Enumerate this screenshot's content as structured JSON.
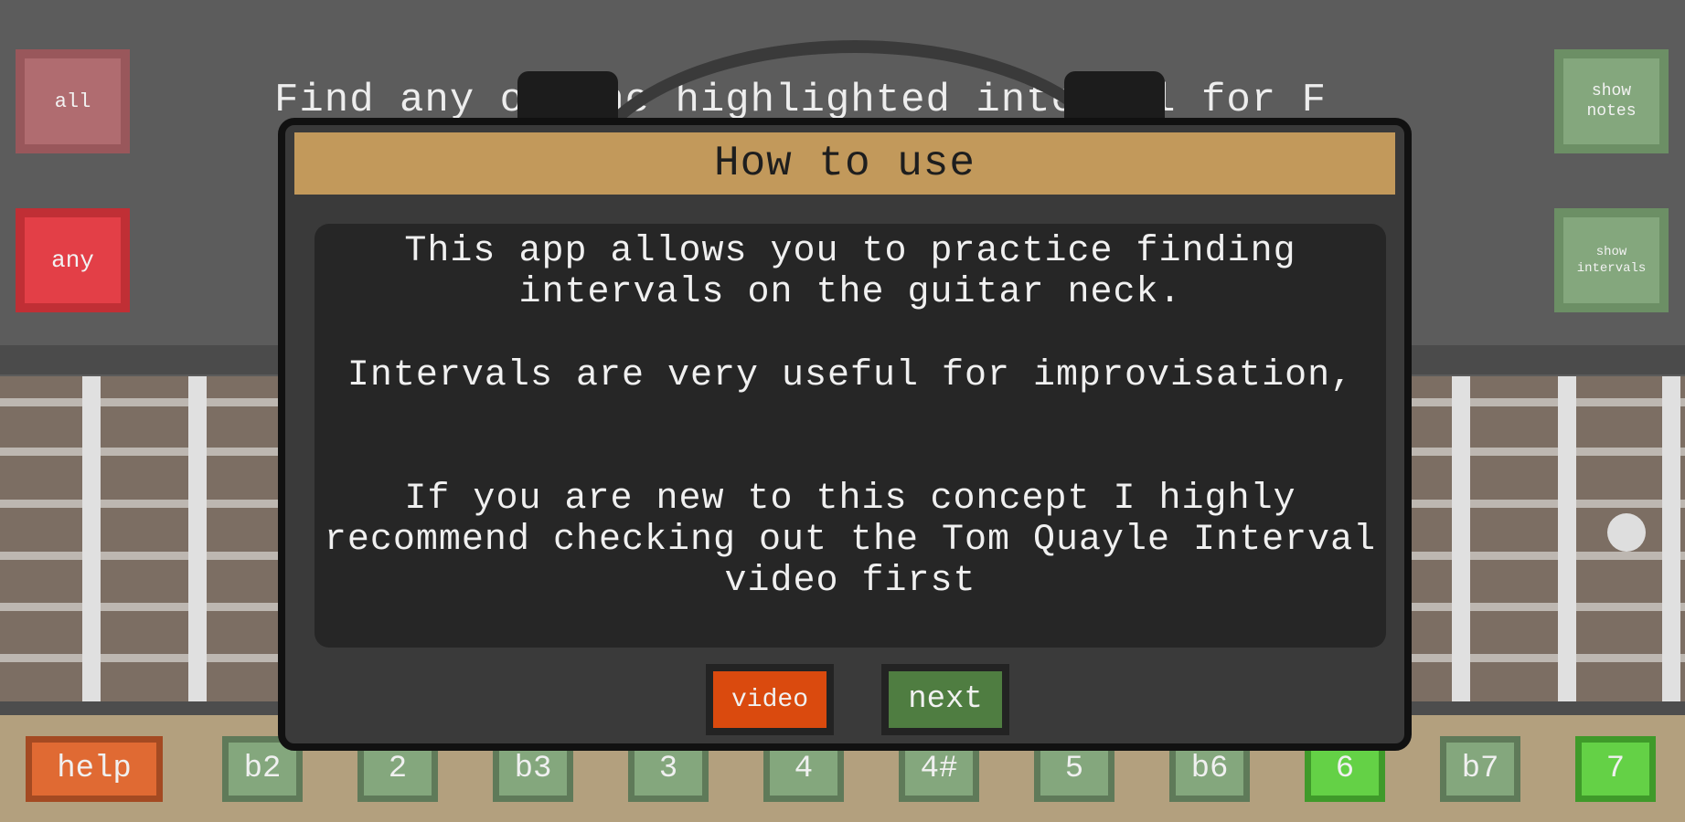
{
  "prompt": "Find any of the highlighted interval for F",
  "left_controls": {
    "all_label": "all",
    "any_label": "any"
  },
  "right_controls": {
    "show_notes_label": "show notes",
    "show_intervals_label": "show intervals"
  },
  "modal": {
    "title": "How to use",
    "paragraphs": [
      "This app allows you to practice finding intervals on the guitar neck.",
      "Intervals are very useful for improvisation,",
      "If you are new to this concept I highly recommend checking out the Tom Quayle Interval video first"
    ],
    "video_label": "video",
    "next_label": "next"
  },
  "bottom_bar": {
    "help_label": "help",
    "intervals": [
      "b2",
      "2",
      "b3",
      "3",
      "4",
      "4#",
      "5",
      "b6",
      "6",
      "b7",
      "7"
    ],
    "highlighted": [
      "6",
      "7"
    ]
  },
  "colors": {
    "accent_header": "#c2995b",
    "video_button": "#da4a0e",
    "next_button": "#4f7d41",
    "interval_green": "#84a77d",
    "interval_highlight": "#64d146",
    "any_button": "#e33f47"
  }
}
